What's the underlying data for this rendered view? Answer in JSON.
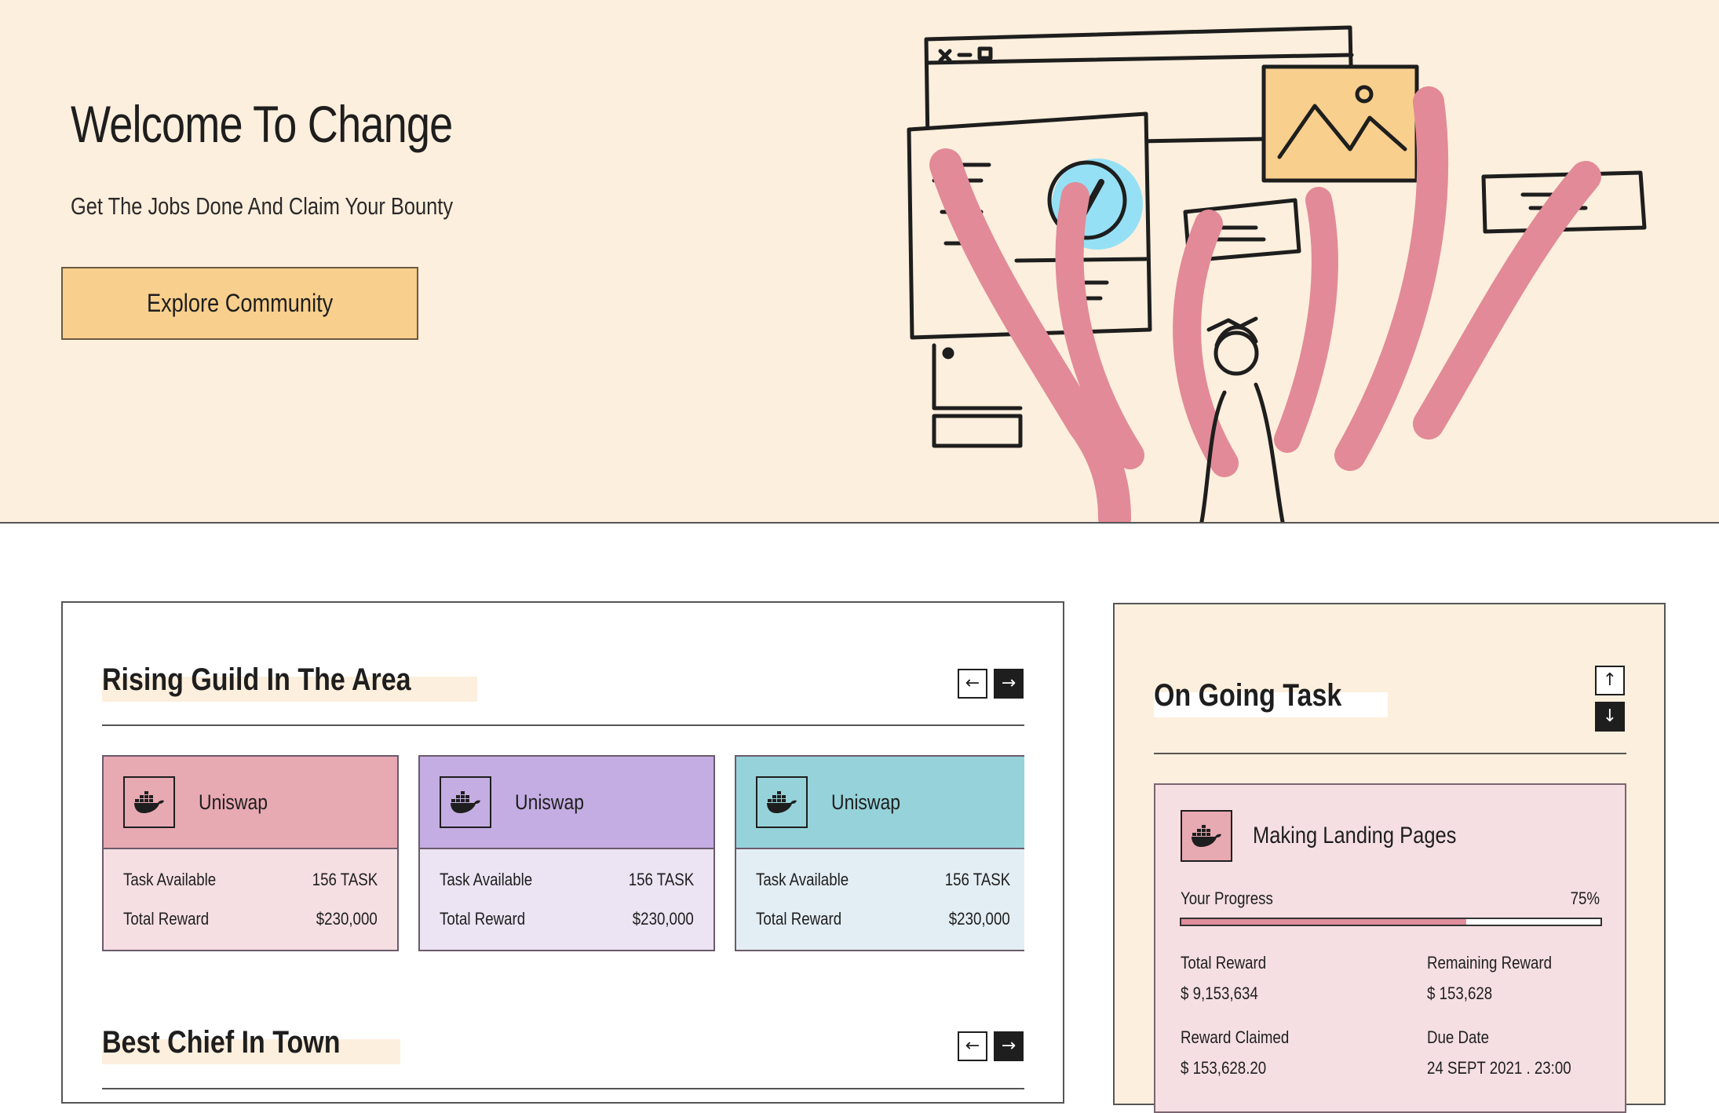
{
  "hero": {
    "title": "Welcome To Change",
    "subtitle": "Get The Jobs Done And Claim Your Bounty",
    "cta_label": "Explore Community"
  },
  "guild_section": {
    "title": "Rising Guild In The Area",
    "cards": [
      {
        "name": "Uniswap",
        "task_label": "Task Available",
        "task_value": "156 TASK",
        "reward_label": "Total Reward",
        "reward_value": "$230,000",
        "top_color": "#e7a9b2",
        "bottom_color": "#f5dfe3"
      },
      {
        "name": "Uniswap",
        "task_label": "Task Available",
        "task_value": "156 TASK",
        "reward_label": "Total Reward",
        "reward_value": "$230,000",
        "top_color": "#c4ade2",
        "bottom_color": "#ece3f3"
      },
      {
        "name": "Uniswap",
        "task_label": "Task Available",
        "task_value": "156 TASK",
        "reward_label": "Total Reward",
        "reward_value": "$230,000",
        "top_color": "#96d2da",
        "bottom_color": "#e3eef4"
      }
    ]
  },
  "chief_section": {
    "title": "Best Chief In Town"
  },
  "task_section": {
    "title": "On Going Task",
    "task": {
      "name": "Making Landing Pages",
      "progress_label": "Your Progress",
      "progress_text": "75%",
      "progress_fraction": 0.68,
      "total_reward_label": "Total Reward",
      "total_reward_value": "$ 9,153,634",
      "remaining_reward_label": "Remaining Reward",
      "remaining_reward_value": "$ 153,628",
      "reward_claimed_label": "Reward Claimed",
      "reward_claimed_value": "$ 153,628.20",
      "due_date_label": "Due Date",
      "due_date_value": "24 SEPT 2021 . 23:00"
    }
  },
  "icons": {
    "guild_logo": "docker-whale-icon",
    "prev": "arrow-left-icon",
    "next": "arrow-right-icon",
    "up": "arrow-up-icon",
    "down": "arrow-down-icon"
  },
  "colors": {
    "hero_bg": "#fdefdd",
    "cta_bg": "#f8cf8c",
    "highlight_cream": "#fdefdd",
    "progress_fill": "#e08e9c"
  }
}
